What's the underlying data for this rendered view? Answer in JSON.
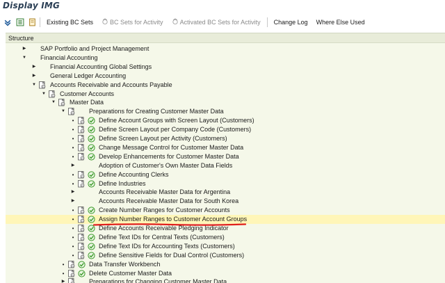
{
  "window": {
    "title": "Display IMG"
  },
  "toolbar": {
    "icons": [
      "expand-icon",
      "tree-icon",
      "notes-icon"
    ],
    "buttons": [
      {
        "label": "Existing BC Sets",
        "disabled": false,
        "icon": ""
      },
      {
        "label": "BC Sets for Activity",
        "disabled": true,
        "icon": "bc-set-icon"
      },
      {
        "label": "Activated BC Sets for Activity",
        "disabled": true,
        "icon": "bc-set-icon"
      },
      {
        "label": "Change Log",
        "disabled": false,
        "icon": ""
      },
      {
        "label": "Where Else Used",
        "disabled": false,
        "icon": ""
      }
    ]
  },
  "structure": {
    "header": "Structure",
    "rows": [
      {
        "label": "SAP Portfolio and Project Management",
        "level": 1,
        "exp": "collapsed",
        "bc": false,
        "exec": false
      },
      {
        "label": "Financial Accounting",
        "level": 1,
        "exp": "expanded",
        "bc": false,
        "exec": false
      },
      {
        "label": "Financial Accounting Global Settings",
        "level": 2,
        "exp": "collapsed",
        "bc": false,
        "exec": false
      },
      {
        "label": "General Ledger Accounting",
        "level": 2,
        "exp": "collapsed",
        "bc": false,
        "exec": false
      },
      {
        "label": "Accounts Receivable and Accounts Payable",
        "level": 2,
        "exp": "expanded",
        "bc": true,
        "exec": false
      },
      {
        "label": "Customer Accounts",
        "level": 3,
        "exp": "expanded",
        "bc": true,
        "exec": false
      },
      {
        "label": "Master Data",
        "level": 4,
        "exp": "expanded",
        "bc": true,
        "exec": false
      },
      {
        "label": "Preparations for Creating Customer Master Data",
        "level": 5,
        "exp": "expanded",
        "bc": true,
        "exec": false
      },
      {
        "label": "Define Account Groups with Screen Layout (Customers)",
        "level": 6,
        "exp": "leaf",
        "bc": true,
        "exec": true
      },
      {
        "label": "Define Screen Layout per Company Code (Customers)",
        "level": 6,
        "exp": "leaf",
        "bc": true,
        "exec": true
      },
      {
        "label": "Define Screen Layout per Activity (Customers)",
        "level": 6,
        "exp": "leaf",
        "bc": true,
        "exec": true
      },
      {
        "label": "Change Message Control for Customer Master Data",
        "level": 6,
        "exp": "leaf",
        "bc": true,
        "exec": true
      },
      {
        "label": "Develop Enhancements for Customer Master Data",
        "level": 6,
        "exp": "leaf",
        "bc": true,
        "exec": true
      },
      {
        "label": "Adoption of Customer's Own Master Data Fields",
        "level": 6,
        "exp": "collapsed",
        "bc": false,
        "exec": false
      },
      {
        "label": "Define Accounting Clerks",
        "level": 6,
        "exp": "leaf",
        "bc": true,
        "exec": true
      },
      {
        "label": "Define Industries",
        "level": 6,
        "exp": "leaf",
        "bc": true,
        "exec": true
      },
      {
        "label": "Accounts Receivable Master Data for Argentina",
        "level": 6,
        "exp": "collapsed",
        "bc": false,
        "exec": false
      },
      {
        "label": "Accounts Receivable Master Data for South Korea",
        "level": 6,
        "exp": "collapsed",
        "bc": false,
        "exec": false
      },
      {
        "label": "Create Number Ranges for Customer Accounts",
        "level": 6,
        "exp": "leaf",
        "bc": true,
        "exec": true
      },
      {
        "label": "Assign Number Ranges to Customer Account Groups",
        "level": 6,
        "exp": "leaf",
        "bc": true,
        "exec": true,
        "selected": true
      },
      {
        "label": "Define Accounts Receivable Pledging Indicator",
        "level": 6,
        "exp": "leaf",
        "bc": true,
        "exec": true
      },
      {
        "label": "Define Text IDs for Central Texts (Customers)",
        "level": 6,
        "exp": "leaf",
        "bc": true,
        "exec": true
      },
      {
        "label": "Define Text IDs for Accounting Texts (Customers)",
        "level": 6,
        "exp": "leaf",
        "bc": true,
        "exec": true
      },
      {
        "label": "Define Sensitive Fields for Dual Control (Customers)",
        "level": 6,
        "exp": "leaf",
        "bc": true,
        "exec": true
      },
      {
        "label": "Data Transfer Workbench",
        "level": 5,
        "exp": "leaf",
        "bc": true,
        "exec": true
      },
      {
        "label": "Delete Customer Master Data",
        "level": 5,
        "exp": "leaf",
        "bc": true,
        "exec": true
      },
      {
        "label": "Preparations for Changing Customer Master Data",
        "level": 5,
        "exp": "collapsed",
        "bc": true,
        "exec": false
      }
    ]
  },
  "colors": {
    "panel_bg": "#f5f8e9",
    "selection_bg": "#fff6b8",
    "annotation_red": "#e0201c",
    "exec_green": "#3c9a2a"
  }
}
